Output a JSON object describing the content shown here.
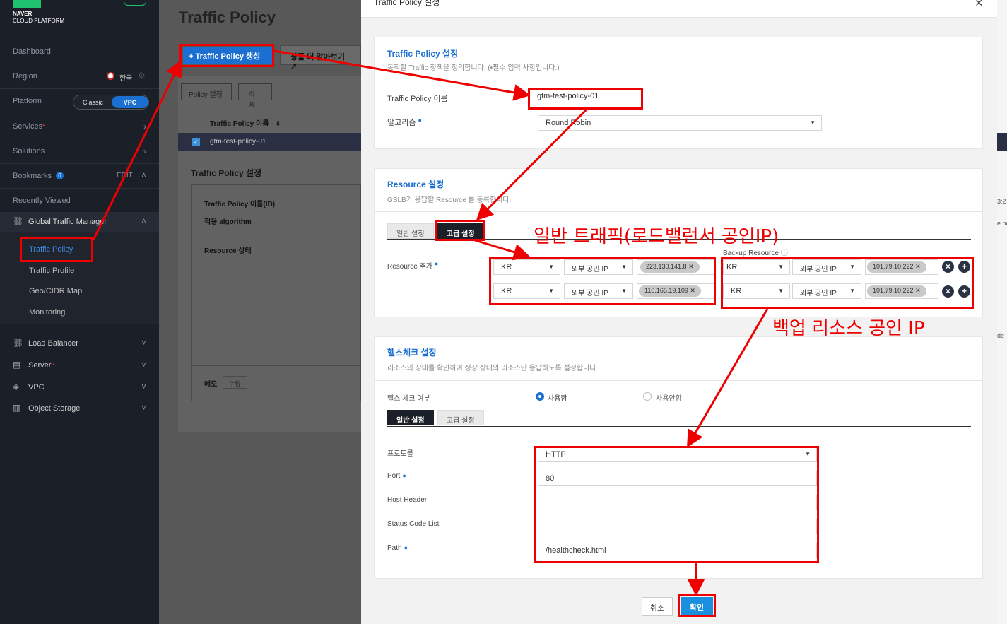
{
  "sidebar": {
    "logo_line1": "NAVER",
    "logo_line2": "CLOUD PLATFORM",
    "dashboard": "Dashboard",
    "region": "Region",
    "region_value": "한국",
    "platform": "Platform",
    "platform_classic": "Classic",
    "platform_vpc": "VPC",
    "services": "Services",
    "solutions": "Solutions",
    "bookmarks": "Bookmarks",
    "bookmarks_count": "0",
    "edit": "EDIT",
    "recently_viewed": "Recently Viewed",
    "gtm": "Global Traffic Manager",
    "gtm_items": [
      "Traffic Policy",
      "Traffic Profile",
      "Geo/CIDR Map",
      "Monitoring"
    ],
    "load_balancer": "Load Balancer",
    "server": "Server",
    "vpc": "VPC",
    "object_storage": "Object Storage"
  },
  "main": {
    "title": "Traffic Policy",
    "create_button": "+ Traffic Policy 생성",
    "learn_more": "상품 더 알아보기",
    "policy_setting_btn": "Policy 설정",
    "delete_btn": "삭제",
    "col_name": "Traffic Policy 이름",
    "row_name": "gtm-test-policy-01",
    "detail_title": "Traffic Policy 설정",
    "detail_id": "Traffic Policy 이름(ID)",
    "detail_algo": "적용 algorithm",
    "detail_resource": "Resource 상태",
    "memo": "메모",
    "memo_edit": "수정"
  },
  "modal": {
    "title": "Traffic Policy 설정",
    "close": "×",
    "section1": {
      "title": "Traffic Policy 설정",
      "desc": "동작할 Traffic 정책을 정의합니다. (•필수 입력 사항입니다.)",
      "name_label": "Traffic Policy 이름",
      "name_value": "gtm-test-policy-01",
      "algo_label": "알고리즘",
      "algo_value": "Round Robin"
    },
    "section2": {
      "title": "Resource 설정",
      "desc": "GSLB가 응답할 Resource 를 등록합니다.",
      "tab_basic": "일반 설정",
      "tab_advanced": "고급 설정",
      "backup_label": "Backup Resource",
      "add_label": "Resource 추가",
      "rows": [
        {
          "region": "KR",
          "type": "외부 공인 IP",
          "ip": "223.130.141.8",
          "backup_region": "KR",
          "backup_type": "외부 공인 IP",
          "backup_ip": "101.79.10.222"
        },
        {
          "region": "KR",
          "type": "외부 공인 IP",
          "ip": "110.165.19.109",
          "backup_region": "KR",
          "backup_type": "외부 공인 IP",
          "backup_ip": "101.79.10.222"
        }
      ]
    },
    "section3": {
      "title": "헬스체크 설정",
      "desc": "리소스의 상태를 확인하여 정상 상태의 리소스만 응답하도록 설정합니다.",
      "hc_label": "헬스 체크 여부",
      "hc_use": "사용함",
      "hc_nouse": "사용안함",
      "tab_basic": "일반 설정",
      "tab_advanced": "고급 설정",
      "protocol_label": "프로토콜",
      "protocol_value": "HTTP",
      "port_label": "Port",
      "port_value": "80",
      "host_label": "Host Header",
      "host_value": "",
      "status_label": "Status Code List",
      "status_value": "",
      "path_label": "Path",
      "path_value": "/healthcheck.html"
    },
    "cancel": "취소",
    "confirm": "확인"
  },
  "annotations": {
    "general_traffic": "일반 트래픽(로드밸런서 공인IP)",
    "backup": "백업 리소스 공인 IP"
  },
  "right_strip": {
    "text1": "3:2",
    "text2": "e.nc",
    "text3": "de"
  }
}
